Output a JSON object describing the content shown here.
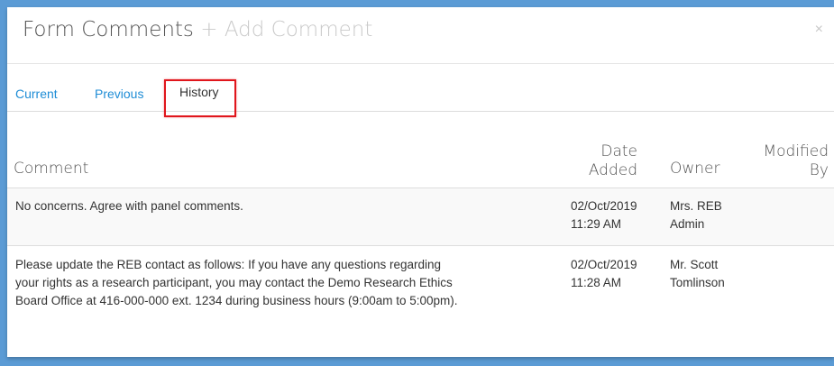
{
  "modal": {
    "title": "Form Comments",
    "add_comment": "+ Add Comment",
    "close": "×"
  },
  "tabs": [
    {
      "label": "Current",
      "active": false
    },
    {
      "label": "Previous",
      "active": false
    },
    {
      "label": "History",
      "active": true
    }
  ],
  "table": {
    "headers": {
      "comment": "Comment",
      "date_line1": "Date",
      "date_line2": "Added",
      "owner": "Owner",
      "modified_line1": "Modified",
      "modified_line2": "By"
    },
    "rows": [
      {
        "comment": "No concerns. Agree with panel comments.",
        "date": "02/Oct/2019",
        "time": "11:29 AM",
        "owner_line1": "Mrs. REB",
        "owner_line2": "Admin",
        "modified_by": ""
      },
      {
        "comment_line1": "Please update the REB contact as follows: If you have any questions regarding",
        "comment_line2": "your rights as a research participant, you may contact the Demo Research Ethics",
        "comment_line3": "Board Office at 416-000-000 ext. 1234 during business hours (9:00am to 5:00pm).",
        "date": "02/Oct/2019",
        "time": "11:28 AM",
        "owner_line1": "Mr. Scott",
        "owner_line2": "Tomlinson",
        "modified_by": ""
      }
    ]
  },
  "colors": {
    "background": "#5b9bd5",
    "link": "#1f8dd6",
    "highlight": "#e0161c"
  }
}
